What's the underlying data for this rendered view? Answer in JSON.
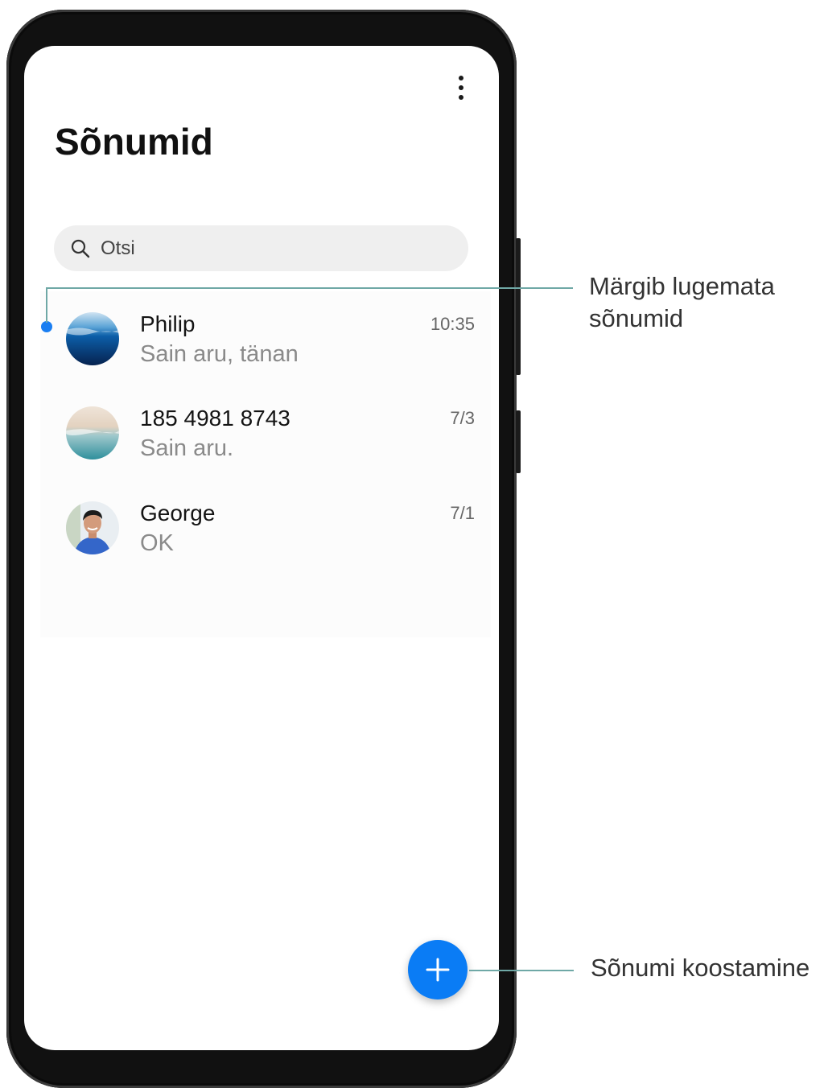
{
  "header": {
    "title": "Sõnumid"
  },
  "search": {
    "placeholder": "Otsi"
  },
  "conversations": [
    {
      "name": "Philip",
      "preview": "Sain aru, tänan",
      "time": "10:35",
      "unread": true,
      "avatar": "ocean-photo"
    },
    {
      "name": "185 4981 8743",
      "preview": "Sain aru.",
      "time": "7/3",
      "unread": false,
      "avatar": "beach-photo"
    },
    {
      "name": "George",
      "preview": "OK",
      "time": "7/1",
      "unread": false,
      "avatar": "person-photo"
    }
  ],
  "annotations": {
    "unread_line1": "Märgib lugemata",
    "unread_line2": "sõnumid",
    "compose": "Sõnumi koostamine"
  },
  "colors": {
    "accent": "#0a7cf5",
    "unread_dot": "#1a7ef2",
    "callout_line": "#6fa8a6"
  }
}
